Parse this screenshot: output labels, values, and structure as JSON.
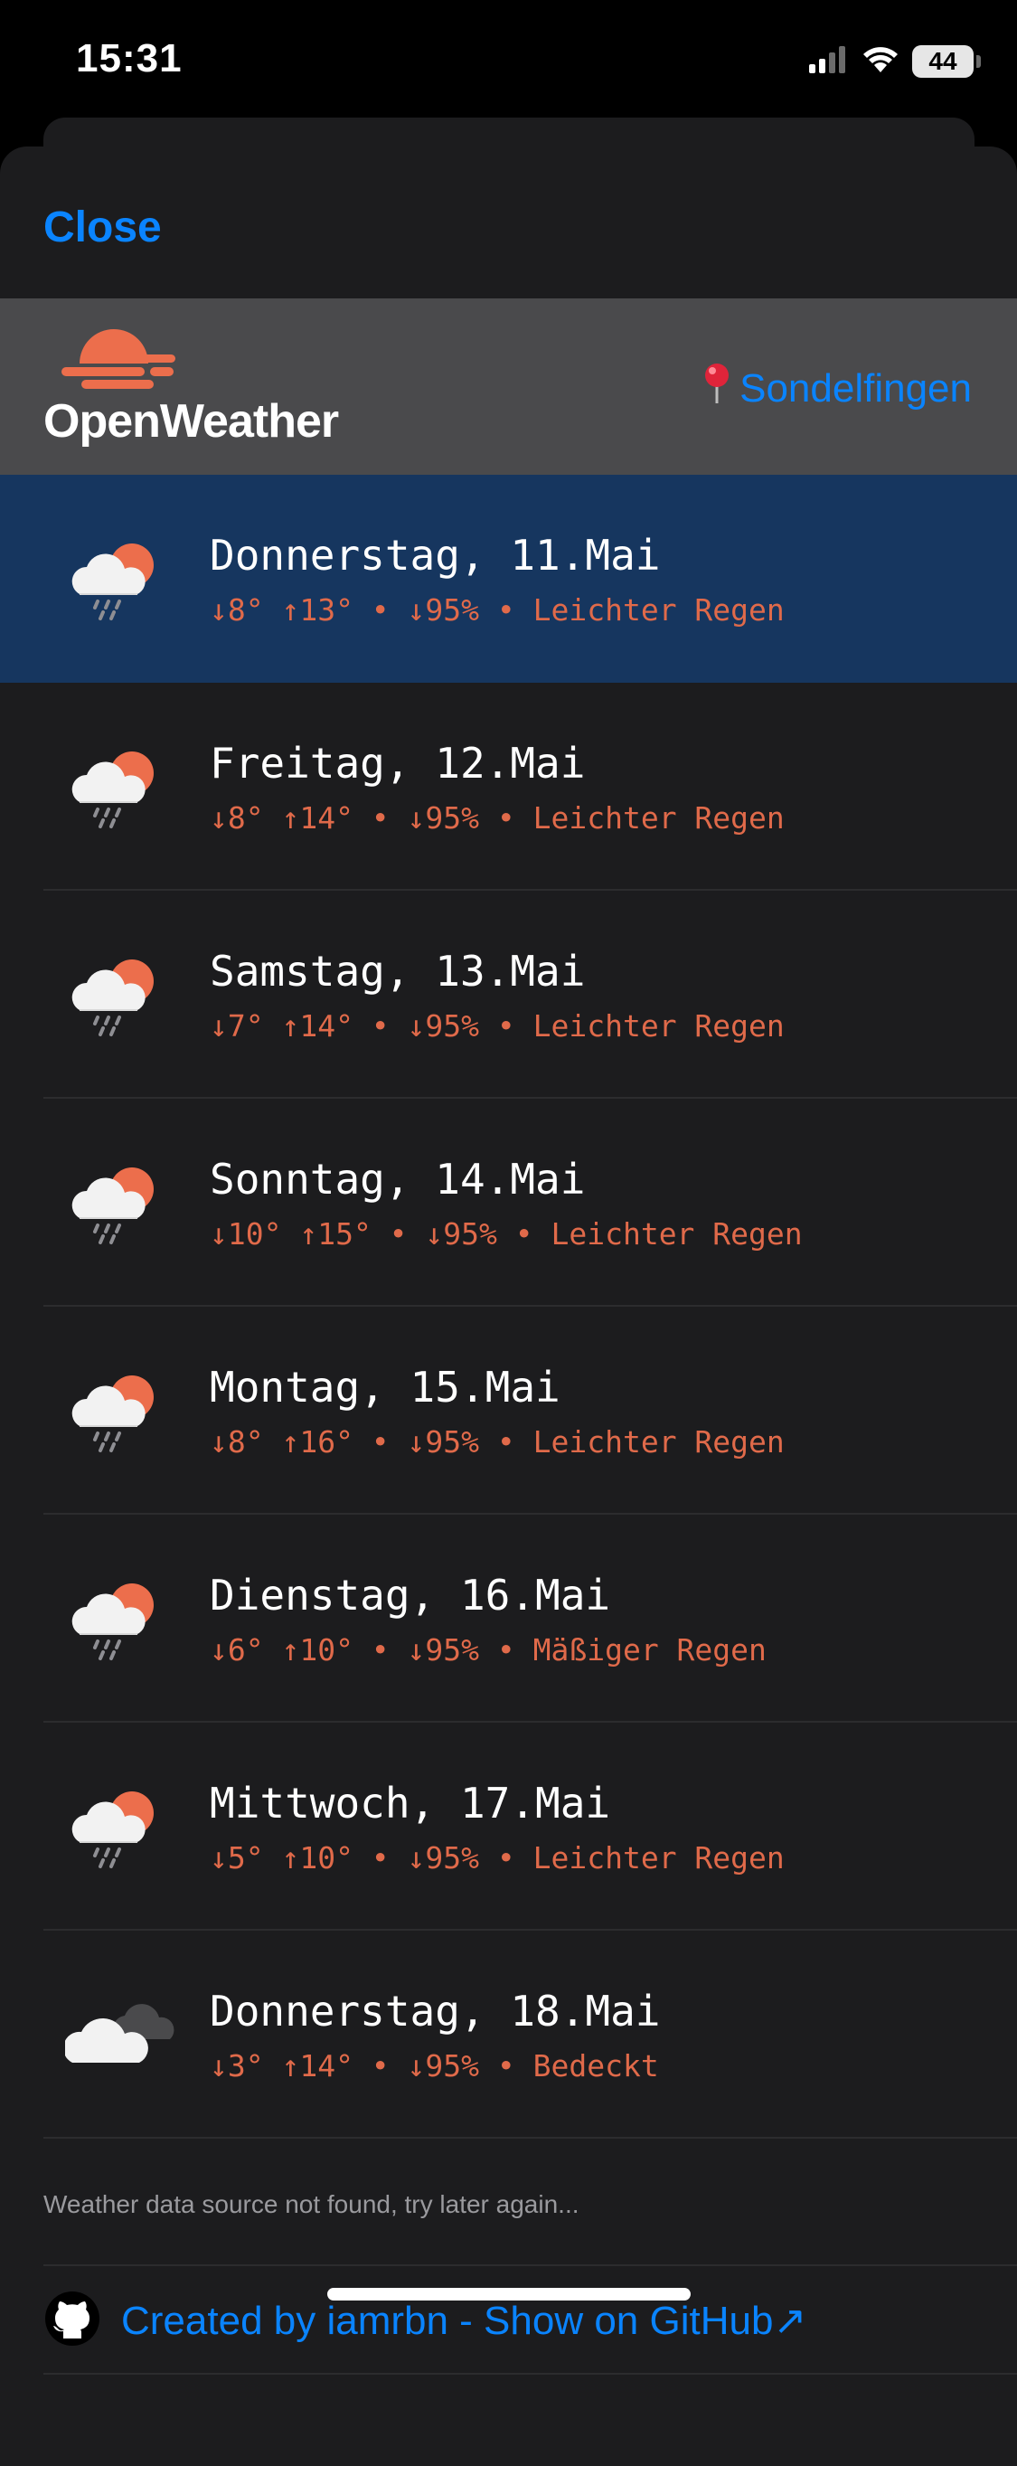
{
  "status_bar": {
    "time": "15:31",
    "battery": "44"
  },
  "sheet": {
    "close_label": "Close",
    "logo_text": "OpenWeather",
    "location": "Sondelfingen",
    "colors": {
      "accent": "#0a84ff",
      "detail": "#e06a4a",
      "selected_row": "#16365f",
      "logo": "#ec6e4c"
    }
  },
  "forecast": [
    {
      "title": "Donnerstag, 11.Mai",
      "detail": "↓8° ↑13° • ↓95% • Leichter Regen",
      "icon": "light-rain-icon",
      "selected": true
    },
    {
      "title": "Freitag, 12.Mai",
      "detail": "↓8° ↑14° • ↓95% • Leichter Regen",
      "icon": "light-rain-icon",
      "selected": false
    },
    {
      "title": "Samstag, 13.Mai",
      "detail": "↓7° ↑14° • ↓95% • Leichter Regen",
      "icon": "light-rain-icon",
      "selected": false
    },
    {
      "title": "Sonntag, 14.Mai",
      "detail": "↓10° ↑15° • ↓95% • Leichter Regen",
      "icon": "light-rain-icon",
      "selected": false
    },
    {
      "title": "Montag, 15.Mai",
      "detail": "↓8° ↑16° • ↓95% • Leichter Regen",
      "icon": "light-rain-icon",
      "selected": false
    },
    {
      "title": "Dienstag, 16.Mai",
      "detail": "↓6° ↑10° • ↓95% • Mäßiger Regen",
      "icon": "moderate-rain-icon",
      "selected": false
    },
    {
      "title": "Mittwoch, 17.Mai",
      "detail": "↓5° ↑10° • ↓95% • Leichter Regen",
      "icon": "light-rain-icon",
      "selected": false
    },
    {
      "title": "Donnerstag, 18.Mai",
      "detail": "↓3° ↑14° • ↓95% • Bedeckt",
      "icon": "overcast-icon",
      "selected": false
    }
  ],
  "footer": {
    "notice": "Weather data source not found, try later again...",
    "github_link": "Created by iamrbn - Show on GitHub↗"
  }
}
